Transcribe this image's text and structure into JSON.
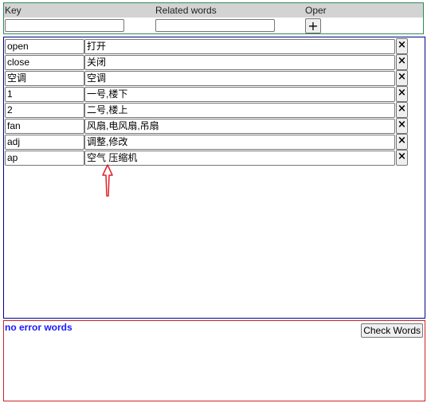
{
  "header": {
    "key_label": "Key",
    "related_label": "Related words",
    "oper_label": "Oper",
    "key_input_value": "",
    "related_input_value": "",
    "add_button_label": "+"
  },
  "rows": [
    {
      "key": "open",
      "words": "打开"
    },
    {
      "key": "close",
      "words": "关闭"
    },
    {
      "key": "空调",
      "words": "空调"
    },
    {
      "key": "1",
      "words": "一号,楼下"
    },
    {
      "key": "2",
      "words": "二号,楼上"
    },
    {
      "key": "fan",
      "words": "风扇,电风扇,吊扇"
    },
    {
      "key": "adj",
      "words": "调整,修改"
    },
    {
      "key": "ap",
      "words": "空气 压缩机"
    }
  ],
  "delete_button_label": "×",
  "error_panel": {
    "message": "no error words",
    "check_button_label": "Check Words"
  },
  "colors": {
    "header_border": "#2e8b57",
    "list_border": "#00008b",
    "error_border": "#cc2222",
    "error_text": "#1a1aff",
    "arrow": "#e0202a"
  },
  "annotation": {
    "icon": "up-arrow-icon"
  }
}
